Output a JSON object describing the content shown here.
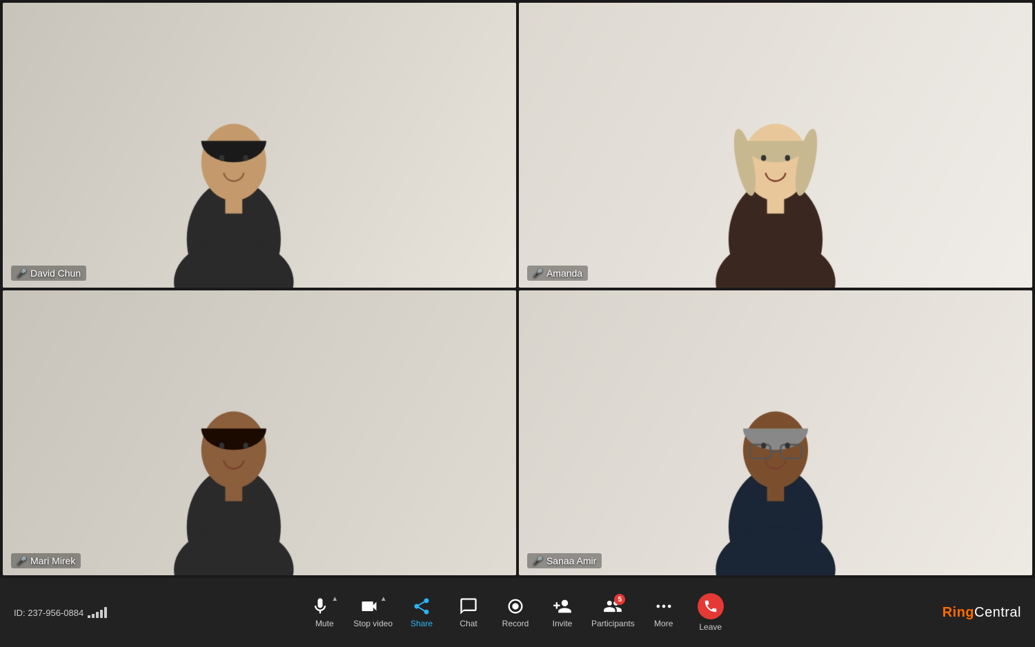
{
  "meeting": {
    "id": "ID: 237-956-0884",
    "signal_bars": [
      3,
      5,
      8,
      11,
      14
    ]
  },
  "participants": [
    {
      "id": "david-chun",
      "name": "David Chun",
      "mic_status": "active",
      "is_active_speaker": true,
      "position": "top-left",
      "bg_color_1": "#c8c0b0",
      "bg_color_2": "#e8e2d8",
      "skin_tone": "#c49a6c"
    },
    {
      "id": "amanda",
      "name": "Amanda",
      "mic_status": "muted",
      "is_active_speaker": false,
      "position": "top-right",
      "bg_color_1": "#ddd8d0",
      "bg_color_2": "#f0ede8",
      "skin_tone": "#e8c89a"
    },
    {
      "id": "mari-mirek",
      "name": "Mari Mirek",
      "mic_status": "active",
      "is_active_speaker": false,
      "position": "bottom-left",
      "bg_color_1": "#d0c8bc",
      "bg_color_2": "#e8e4de",
      "skin_tone": "#8B5E3C"
    },
    {
      "id": "sanaa-amir",
      "name": "Sanaa Amir",
      "mic_status": "active",
      "is_active_speaker": false,
      "position": "bottom-right",
      "bg_color_1": "#dcd8d0",
      "bg_color_2": "#eeeae4",
      "skin_tone": "#7B4F2E"
    }
  ],
  "toolbar": {
    "mute_label": "Mute",
    "stop_video_label": "Stop video",
    "share_label": "Share",
    "chat_label": "Chat",
    "record_label": "Record",
    "invite_label": "Invite",
    "participants_label": "Participants",
    "more_label": "More",
    "leave_label": "Leave",
    "participants_count": "5",
    "share_active": true
  },
  "brand": {
    "ring": "Ring",
    "central": "Central",
    "full": "RingCentral"
  }
}
